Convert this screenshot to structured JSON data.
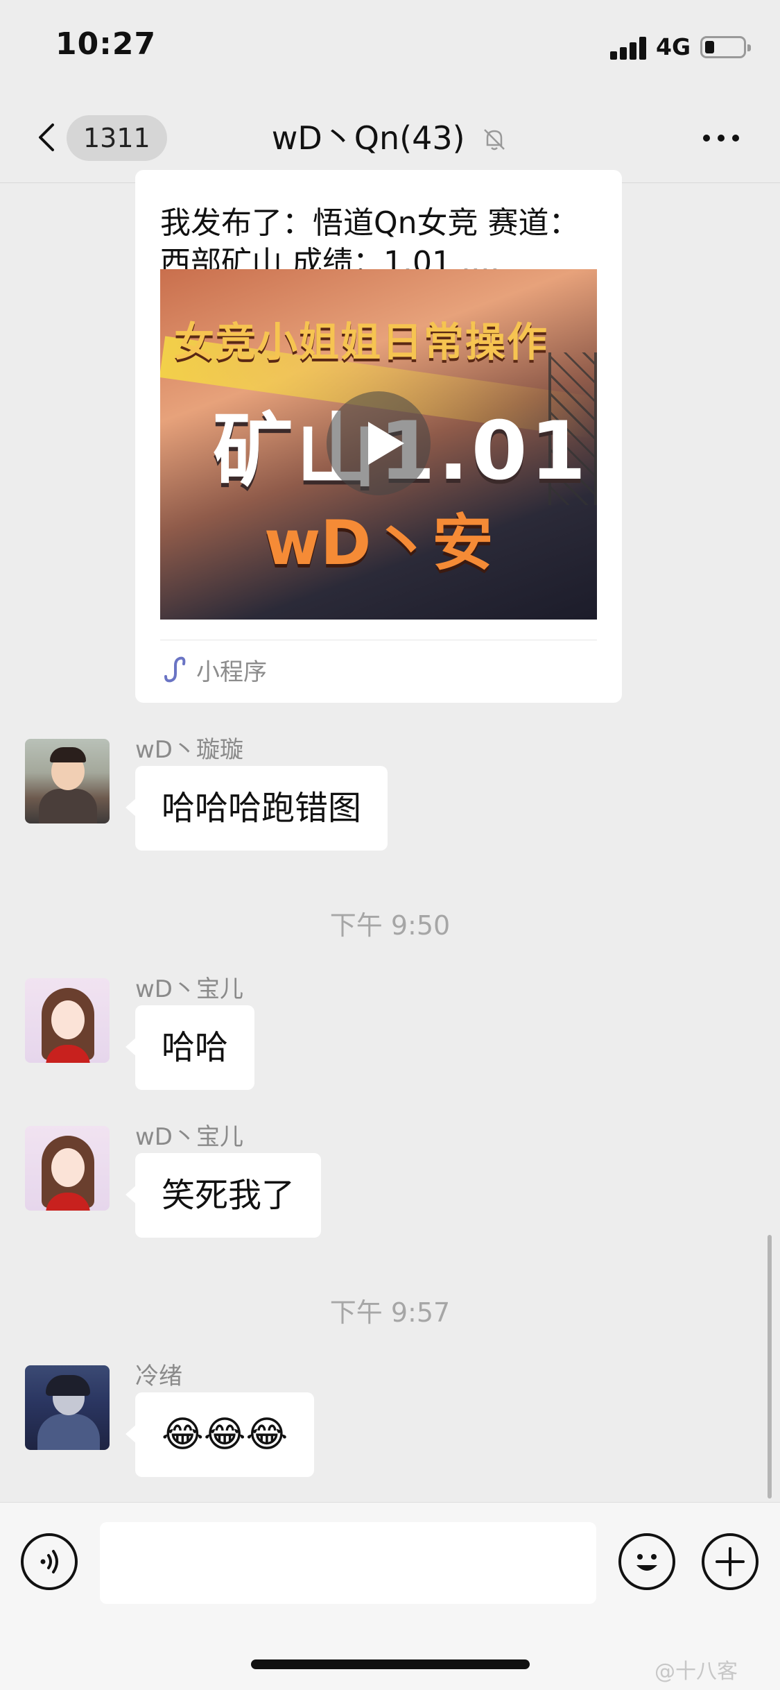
{
  "status_bar": {
    "time": "10:27",
    "network": "4G",
    "battery_icon": "battery-icon",
    "signal_icon": "signal-icon"
  },
  "nav": {
    "back_icon": "chevron-left-icon",
    "unread_count": "1311",
    "title": "wD丶Qn(43)",
    "mute_icon": "bell-slash-icon",
    "more_icon": "more-icon"
  },
  "mini_program": {
    "description": "我发布了：悟道Qn女竞 赛道：西部矿山 成绩：1.01 ....",
    "thumbnail_line1": "女竞小姐姐日常操作",
    "thumbnail_line2": "矿山1.01",
    "thumbnail_line3": "wD丶安",
    "label": "小程序",
    "icon": "mini-program-icon"
  },
  "messages": [
    {
      "sender": "wD丶璇璇",
      "text": "哈哈哈跑错图"
    },
    {
      "sender": "wD丶宝儿",
      "text": "哈哈"
    },
    {
      "sender": "wD丶宝儿",
      "text": "笑死我了"
    },
    {
      "sender": "冷绪",
      "text": "😂😂😂"
    }
  ],
  "timestamps": [
    "下午 9:50",
    "下午 9:57"
  ],
  "input_bar": {
    "voice_icon": "voice-icon",
    "emoji_icon": "smile-icon",
    "plus_icon": "plus-icon"
  },
  "watermark": "@十八客"
}
